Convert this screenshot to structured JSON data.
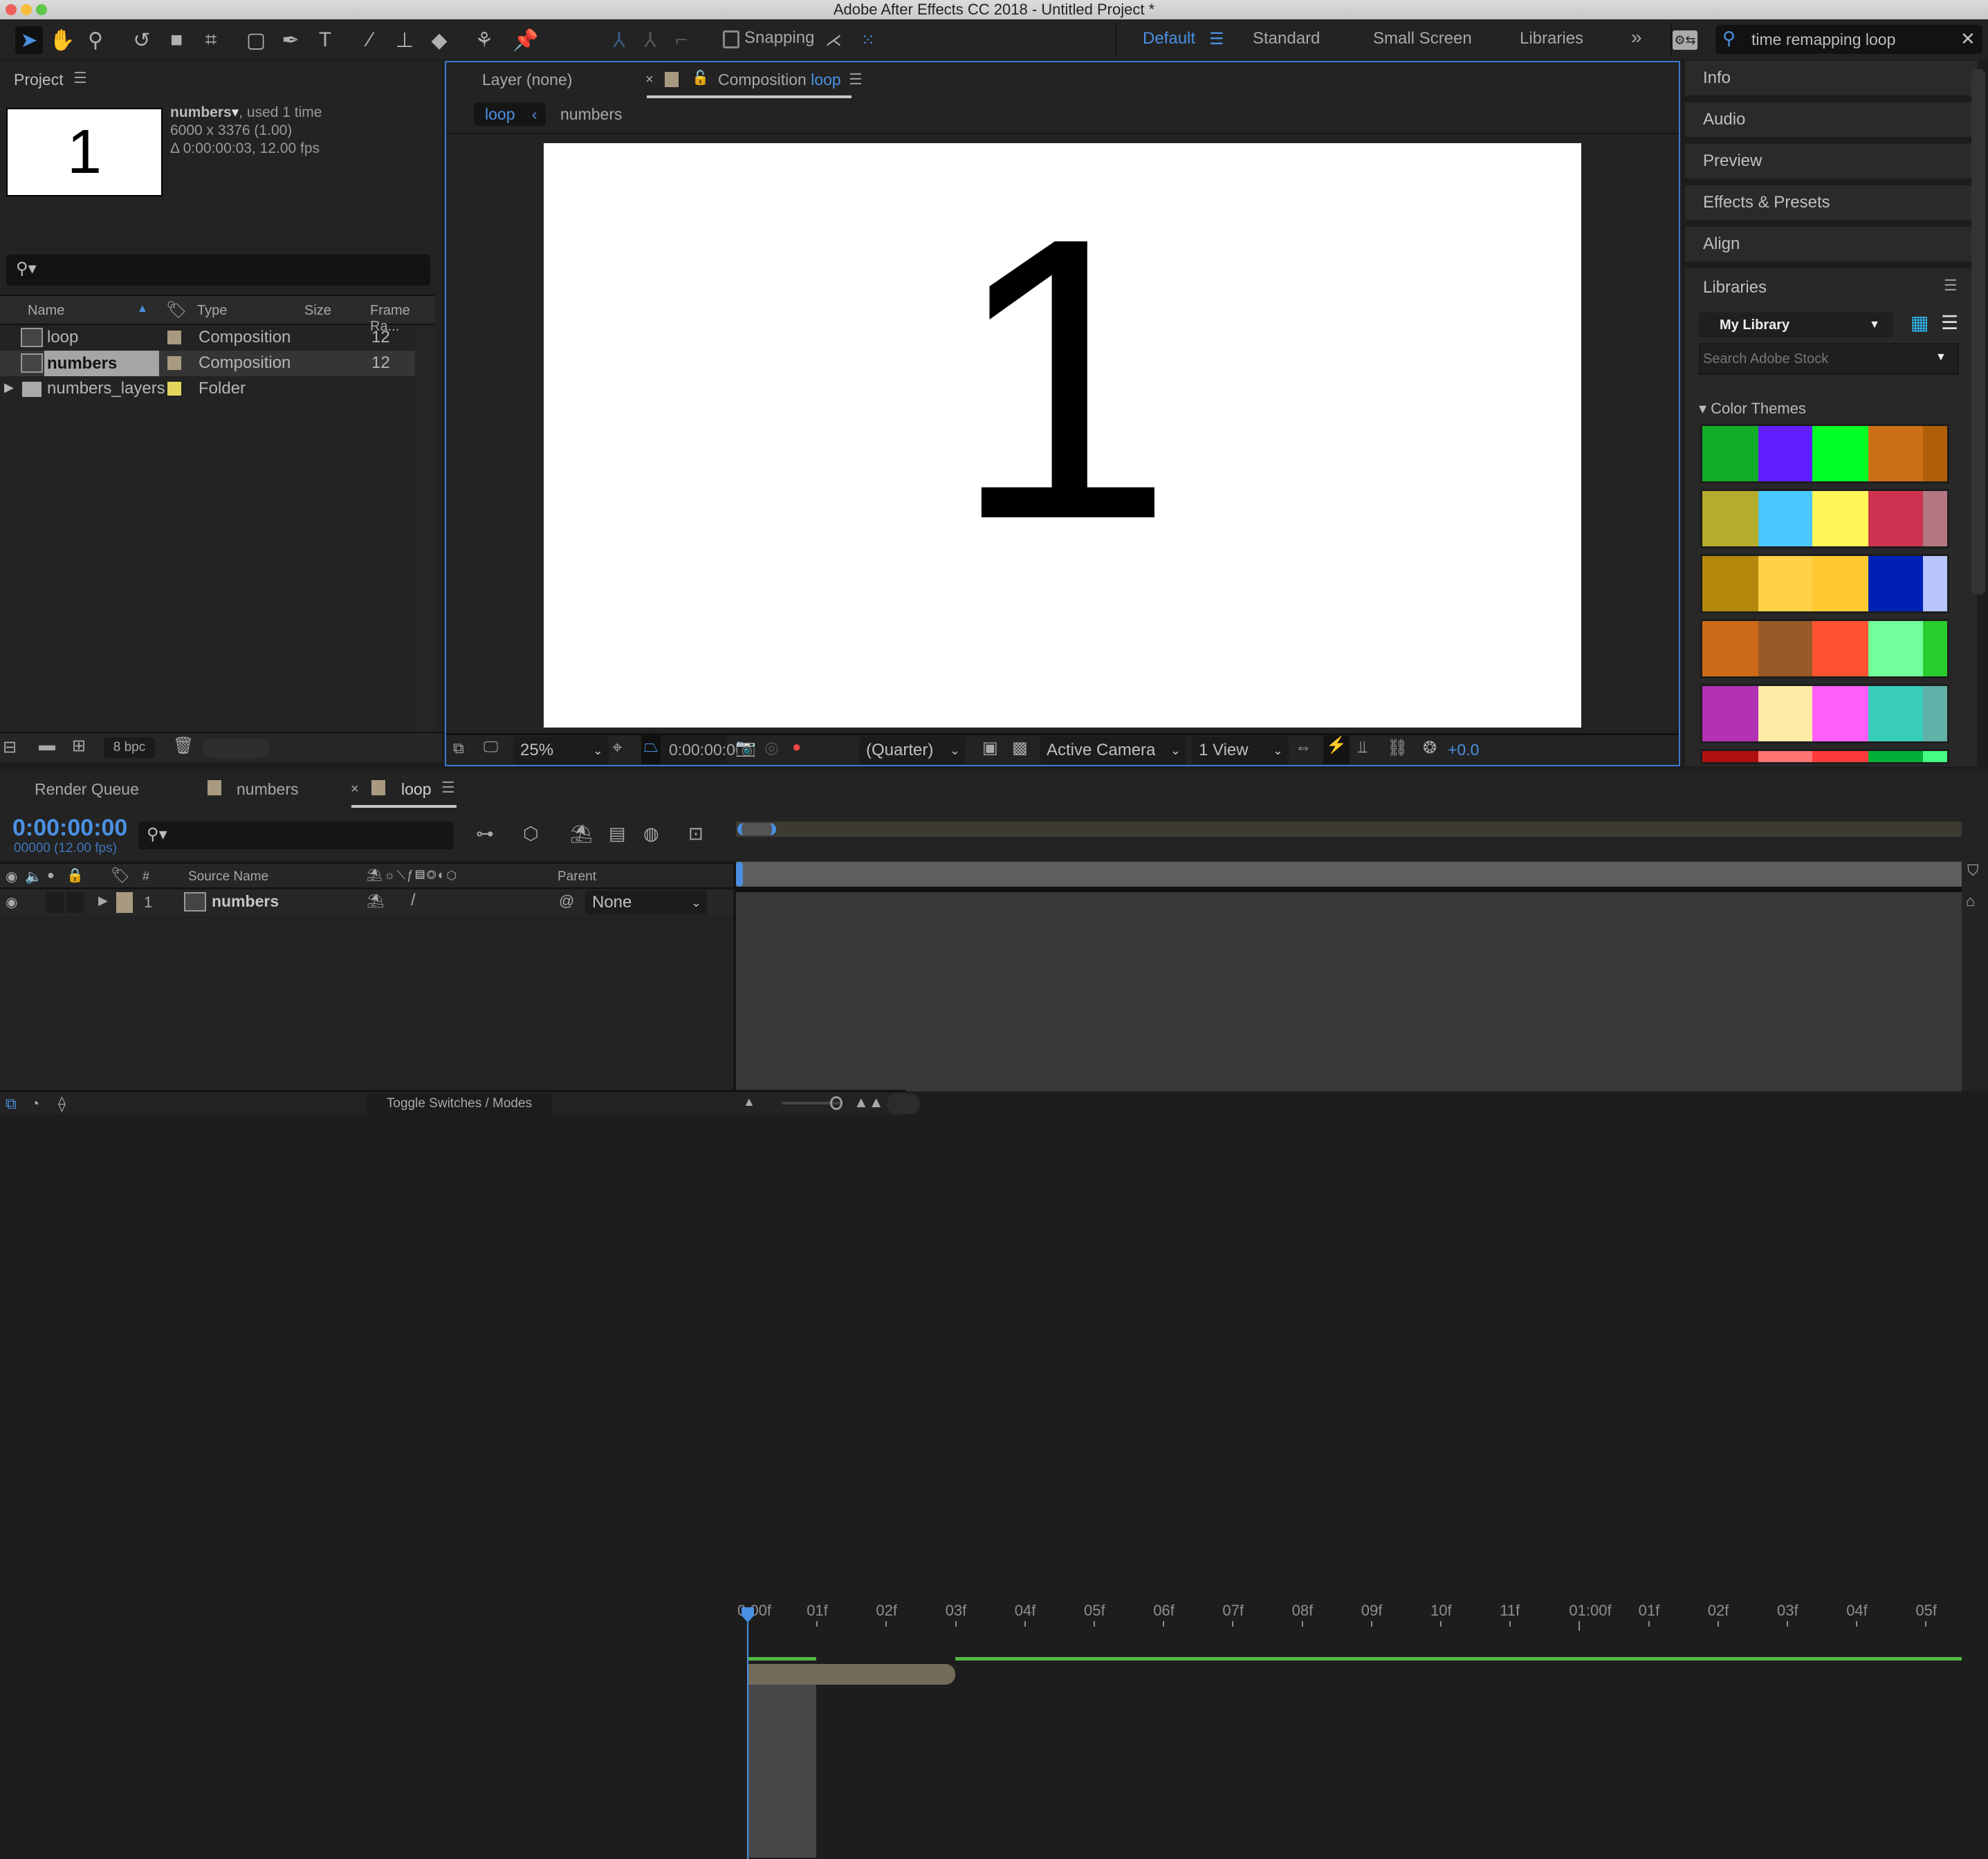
{
  "window": {
    "title": "Adobe After Effects CC 2018 - Untitled Project *"
  },
  "toolbar": {
    "tools": [
      "selection-tool",
      "hand-tool",
      "zoom-tool",
      "rotate-tool",
      "camera-tool",
      "pan-behind-tool",
      "rectangle-tool",
      "pen-tool",
      "type-tool",
      "brush-tool",
      "clone-stamp-tool",
      "eraser-tool",
      "roto-brush-tool",
      "puppet-pin-tool"
    ],
    "snapping_label": "Snapping",
    "workspaces": [
      "Default",
      "Standard",
      "Small Screen",
      "Libraries"
    ],
    "active_workspace": "Default",
    "search_value": "time remapping loop"
  },
  "project": {
    "title": "Project",
    "thumbnail_text": "1",
    "selected_name": "numbers",
    "used": ", used 1 time",
    "dimensions": "6000 x 3376 (1.00)",
    "duration": "Δ 0:00:00:03, 12.00 fps",
    "columns": [
      "Name",
      "Type",
      "Size",
      "Frame Ra..."
    ],
    "items": [
      {
        "name": "loop",
        "type": "Composition",
        "size": "",
        "fps": "12",
        "label_color": "#a89a80"
      },
      {
        "name": "numbers",
        "type": "Composition",
        "size": "",
        "fps": "12",
        "label_color": "#a89a80"
      },
      {
        "name": "numbers_layers",
        "type": "Folder",
        "size": "",
        "fps": "",
        "label_color": "#e4d65c"
      }
    ],
    "bpc": "8 bpc"
  },
  "comp": {
    "layer_tab": "Layer (none)",
    "comp_tab_prefix": "Composition",
    "comp_tab_name": "loop",
    "breadcrumb": [
      "loop",
      "numbers"
    ],
    "canvas_text": "1",
    "zoom": "25%",
    "timecode": "0:00:00:00",
    "resolution": "(Quarter)",
    "camera": "Active Camera",
    "views": "1 View",
    "exposure": "+0.0"
  },
  "right_panel": {
    "items": [
      "Info",
      "Audio",
      "Preview",
      "Effects & Presets",
      "Align"
    ],
    "libraries": {
      "title": "Libraries",
      "library": "My Library",
      "search_placeholder": "Search Adobe Stock",
      "section": "Color Themes",
      "themes": [
        [
          "#13ae27",
          "#611cff",
          "#00ff24",
          "#cb7015",
          "#b05f08"
        ],
        [
          "#b5ab2c",
          "#4bc8ff",
          "#fff658",
          "#cd3350",
          "#b27782"
        ],
        [
          "#b4870d",
          "#ffd146",
          "#ffc931",
          "#0020b5",
          "#b9c5ff"
        ],
        [
          "#cc6a17",
          "#975a28",
          "#ff5230",
          "#72ff9b",
          "#28cd2d"
        ],
        [
          "#b331b3",
          "#fdeca6",
          "#ff5ef9",
          "#37cdb9",
          "#62b1a8"
        ],
        [
          "#b00f0f",
          "#ff7373",
          "#ff3a3a",
          "#00af38",
          "#44ff82"
        ]
      ]
    }
  },
  "timeline": {
    "tabs": [
      "Render Queue",
      "numbers",
      "loop"
    ],
    "active_tab": "loop",
    "timecode": "0:00:00:00",
    "frame_info": "00000 (12.00 fps)",
    "columns": {
      "num": "#",
      "source": "Source Name",
      "parent": "Parent"
    },
    "layers": [
      {
        "index": "1",
        "name": "numbers",
        "parent": "None",
        "label_color": "#a89a80"
      }
    ],
    "ruler_ticks": [
      "0:00f",
      "01f",
      "02f",
      "03f",
      "04f",
      "05f",
      "06f",
      "07f",
      "08f",
      "09f",
      "10f",
      "11f",
      "01:00f",
      "01f",
      "02f",
      "03f",
      "04f",
      "05f"
    ],
    "layer_bar_end_frame": 3,
    "work_area_frames": [
      0,
      1
    ],
    "toggle_label": "Toggle Switches / Modes"
  },
  "colors": {
    "accent": "#4a90e2",
    "panel": "#232323",
    "bg": "#1d1d1d"
  }
}
